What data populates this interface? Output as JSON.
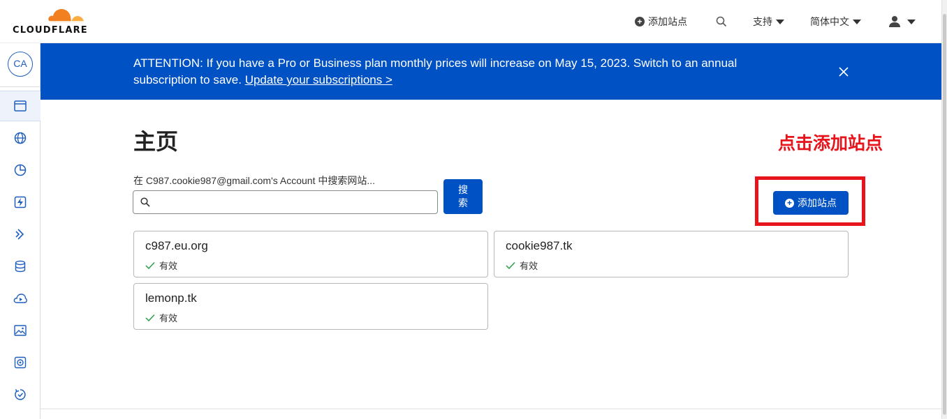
{
  "brand": {
    "wordmark": "CLOUDFLARE",
    "cloud_color": "#f38020",
    "cloud_light": "#fbad41"
  },
  "topnav": {
    "add_site": "添加站点",
    "support": "支持",
    "language": "简体中文"
  },
  "sidebar": {
    "avatar_initials": "CA",
    "items": [
      {
        "icon": "browser-window-icon",
        "active": true
      },
      {
        "icon": "globe-icon"
      },
      {
        "icon": "pie-chart-icon"
      },
      {
        "icon": "lightning-workers-icon"
      },
      {
        "icon": "pages-chevron-icon"
      },
      {
        "icon": "database-icon"
      },
      {
        "icon": "cloud-stream-icon"
      },
      {
        "icon": "image-icon"
      },
      {
        "icon": "gear-cog-icon"
      },
      {
        "icon": "refresh-history-icon"
      }
    ]
  },
  "banner": {
    "text": "ATTENTION: If you have a Pro or Business plan monthly prices will increase on May 15, 2023. Switch to an annual subscription to save.",
    "link": "Update your subscriptions >",
    "bg_color": "#0051c3"
  },
  "main": {
    "title": "主页",
    "annotation": "点击添加站点",
    "search_label": "在 C987.cookie987@gmail.com's Account 中搜索网站...",
    "search_placeholder": "",
    "search_button_line1": "搜",
    "search_button_line2": "索",
    "add_site_button": "添加站点",
    "sites": [
      {
        "domain": "c987.eu.org",
        "status": "有效"
      },
      {
        "domain": "cookie987.tk",
        "status": "有效"
      },
      {
        "domain": "lemonp.tk",
        "status": "有效"
      }
    ]
  },
  "colors": {
    "accent": "#0051c3",
    "annotation_red": "#e8141c",
    "status_green": "#2c9e4b"
  }
}
